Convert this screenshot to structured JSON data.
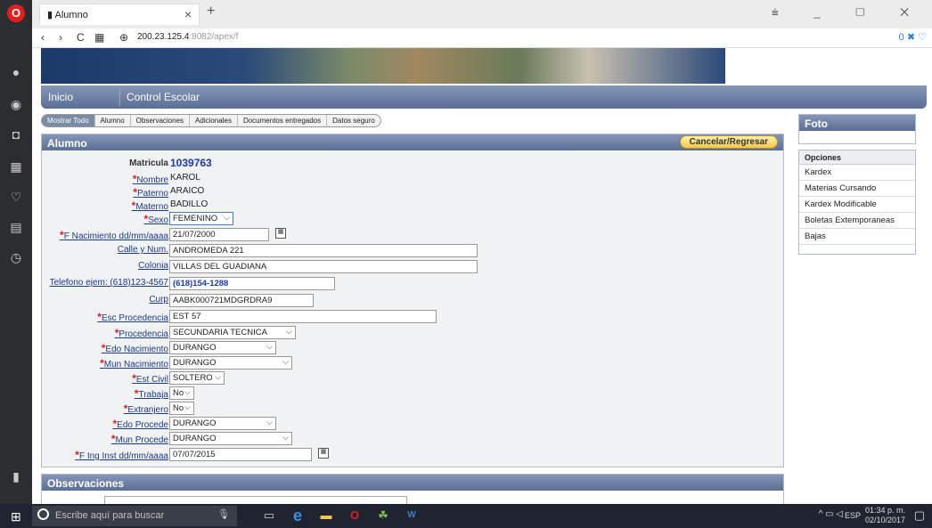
{
  "browser": {
    "tab_title": "Alumno",
    "new_tab_symbol": "+",
    "close_symbol": "×",
    "url_host": "200.23.125.4",
    "url_rest": ":8082/apex/f",
    "addr_badge": "0"
  },
  "menu": {
    "items": [
      "Inicio",
      "Control Escolar"
    ]
  },
  "subtabs": [
    "Mostrar Todo",
    "Alumno",
    "Observaciones",
    "Adicionales",
    "Documentos entregados",
    "Datos seguro"
  ],
  "form": {
    "title": "Alumno",
    "cancel_label": "Cancelar/Regresar",
    "matricula_label": "Matricula",
    "matricula": "1039763",
    "nombre_label": "Nombre",
    "nombre": "KAROL",
    "paterno_label": "Paterno",
    "paterno": "ARAICO",
    "materno_label": "Materno",
    "materno": "BADILLO",
    "sexo_label": "Sexo",
    "sexo": "FEMENINO",
    "fnac_label": "F Nacimiento dd/mm/aaaa",
    "fnac": "21/07/2000",
    "calle_label": "Calle y Num.",
    "calle": "ANDROMEDA 221",
    "colonia_label": "Colonia",
    "colonia": "VILLAS DEL GUADIANA",
    "tel_label": "Telefono ejem: (618)123-4567",
    "tel": "(618)154-1288",
    "curp_label": "Curp",
    "curp": "AABK000721MDGRDRA9",
    "esc_label": "Esc Procedencia",
    "esc": "EST 57",
    "proc_label": "Procedencia",
    "proc": "SECUNDARIA TECNICA",
    "edonac_label": "Edo Nacimiento",
    "edonac": "DURANGO",
    "munnac_label": "Mun Nacimiento",
    "munnac": "DURANGO",
    "civil_label": "Est Civil",
    "civil": "SOLTERO",
    "trabaja_label": "Trabaja",
    "trabaja": "No",
    "extranjero_label": "Extranjero",
    "extranjero": "No",
    "edoproc_label": "Edo Procede",
    "edoproc": "DURANGO",
    "munproc_label": "Mun Procede",
    "munproc": "DURANGO",
    "fing_label": "F Ing Inst dd/mm/aaaa",
    "fing": "07/07/2015"
  },
  "observaciones": {
    "title": "Observaciones"
  },
  "foto": {
    "title": "Foto"
  },
  "opciones": {
    "title": "Opciones",
    "items": [
      "Kardex",
      "Materias Cursando",
      "Kardex Modificable",
      "Boletas Extemporaneas",
      "Bajas"
    ]
  },
  "taskbar": {
    "search_placeholder": "Escribe aquí para buscar",
    "lang": "ESP",
    "time": "01:34 p. m.",
    "date": "02/10/2017"
  }
}
